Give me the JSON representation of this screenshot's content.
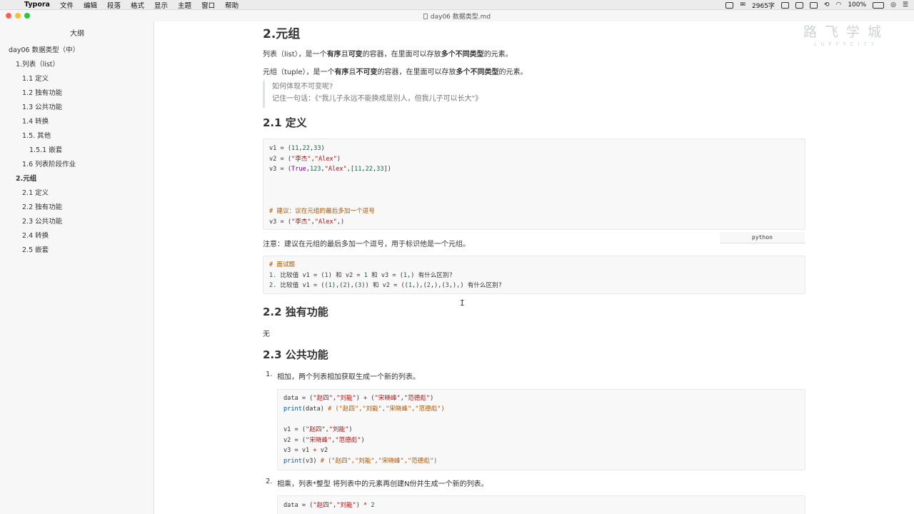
{
  "menubar": {
    "app": "Typora",
    "items": [
      "文件",
      "编辑",
      "段落",
      "格式",
      "显示",
      "主题",
      "窗口",
      "帮助"
    ],
    "word_count": "2965字",
    "battery": "100%"
  },
  "window": {
    "title": "day06 数据类型.md"
  },
  "sidebar": {
    "title": "大纲",
    "items": [
      {
        "label": "day06 数据类型（中）"
      },
      {
        "label": "1.列表（list）"
      },
      {
        "label": "1.1 定义"
      },
      {
        "label": "1.2 独有功能"
      },
      {
        "label": "1.3 公共功能"
      },
      {
        "label": "1.4 转换"
      },
      {
        "label": "1.5. 其他"
      },
      {
        "label": "1.5.1 嵌套"
      },
      {
        "label": "1.6 列表阶段作业"
      },
      {
        "label": "2.元组"
      },
      {
        "label": "2.1 定义"
      },
      {
        "label": "2.2 独有功能"
      },
      {
        "label": "2.3 公共功能"
      },
      {
        "label": "2.4 转换"
      },
      {
        "label": "2.5 嵌套"
      }
    ]
  },
  "watermark": {
    "big": "路飞学城",
    "small": "LUFFYCITY"
  },
  "content": {
    "h_tuple": "2.元组",
    "p1": {
      "a": "列表（list），是一个",
      "b1": "有序",
      "c": "且",
      "b2": "可变",
      "d": "的容器，在里面可以存放",
      "b3": "多个不同类型",
      "e": "的元素。"
    },
    "p2": {
      "a": "元组（tuple），是一个",
      "b1": "有序",
      "c": "且",
      "b2": "不可变",
      "d": "的容器，在里面可以存放",
      "b3": "多个不同类型",
      "e": "的元素。"
    },
    "quote": [
      "如何体现不可变呢?",
      "记住一句话：《\"我儿子永远不能换成是别人，但我儿子可以长大\"》"
    ],
    "h_def": "2.1 定义",
    "lang": "python",
    "note": "注意：建议在元组的最后多加一个逗号，用于标识他是一个元组。",
    "h_own": "2.2 独有功能",
    "own_none": "无",
    "h_common": "2.3 公共功能",
    "ol1_num": "1.",
    "ol1_text": "相加，两个列表相加获取生成一个新的列表。",
    "ol2_num": "2.",
    "ol2_text": "相乘，列表*整型 将列表中的元素再创建N份并生成一个新的列表。"
  },
  "code_def": [
    "v1 = (11,22,33)",
    "v2 = (\"李杰\",\"Alex\")",
    "v3 = (True,123,\"Alex\",[11,22,33])",
    "",
    "",
    "",
    "# 建议：议在元组的最后多加一个逗号",
    "v3 = (\"李杰\",\"Alex\",)"
  ],
  "code_interview": [
    "# 面试题",
    "1. 比较值 v1 = (1) 和 v2 = 1 和 v3 = (1,) 有什么区别?",
    "2. 比较值 v1 = ((1),(2),(3)) 和 v2 = ((1,),(2,),(3,),) 有什么区别?"
  ],
  "code_add": [
    "data = (\"赵四\",\"刘能\") + (\"宋晓峰\",\"范德彪\")",
    "print(data) # (\"赵四\",\"刘能\",\"宋晓峰\",\"范德彪\")",
    "",
    "v1 = (\"赵四\",\"刘能\")",
    "v2 = (\"宋晓峰\",\"范德彪\")",
    "v3 = v1 + v2",
    "print(v3) # (\"赵四\",\"刘能\",\"宋晓峰\",\"范德彪\")"
  ],
  "code_mul": [
    "data = (\"赵四\",\"刘能\") * 2"
  ]
}
